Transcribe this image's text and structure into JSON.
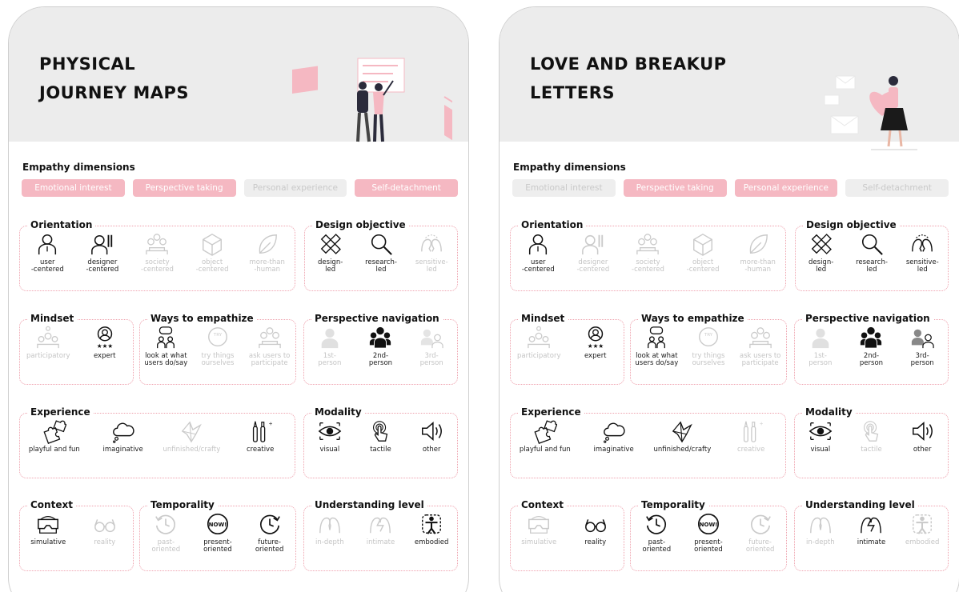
{
  "empathy_dimensions_title": "Empathy dimensions",
  "cards": [
    {
      "title": "PHYSICAL\nJOURNEY MAPS",
      "dimensions": [
        {
          "label": "Emotional interest",
          "active": true
        },
        {
          "label": "Perspective taking",
          "active": true
        },
        {
          "label": "Personal experience",
          "active": false
        },
        {
          "label": "Self-detachment",
          "active": true
        }
      ],
      "sections": [
        {
          "title": "Orientation",
          "items": [
            {
              "label": "user\n-centered",
              "icon": "user-icon",
              "active": true
            },
            {
              "label": "designer\n-centered",
              "icon": "designer-icon",
              "active": true
            },
            {
              "label": "society\n-centered",
              "icon": "crowd-icon",
              "active": false
            },
            {
              "label": "object\n-centered",
              "icon": "cube-icon",
              "active": false
            },
            {
              "label": "more-than\n-human",
              "icon": "leaf-icon",
              "active": false
            }
          ]
        },
        {
          "title": "Design objective",
          "items": [
            {
              "label": "design-\nled",
              "icon": "ruler-pencil-icon",
              "active": true
            },
            {
              "label": "research-\nled",
              "icon": "magnifier-icon",
              "active": true
            },
            {
              "label": "sensitive-\nled",
              "icon": "faces-icon",
              "active": false
            }
          ]
        },
        {
          "title": "Mindset",
          "items": [
            {
              "label": "participatory",
              "icon": "group-idea-icon",
              "active": false
            },
            {
              "label": "expert",
              "icon": "expert-icon",
              "active": true
            }
          ]
        },
        {
          "title": "Ways to empathize",
          "items": [
            {
              "label": "look at what\nusers do/say",
              "icon": "speech-people-icon",
              "active": true
            },
            {
              "label": "try things\nourselves",
              "icon": "try-icon",
              "active": false
            },
            {
              "label": "ask users to\nparticipate",
              "icon": "crowd-icon",
              "active": false
            }
          ]
        },
        {
          "title": "Perspective navigation",
          "items": [
            {
              "label": "1st-\nperson",
              "icon": "person-icon",
              "active": false
            },
            {
              "label": "2nd-\nperson",
              "icon": "group-icon",
              "active": true
            },
            {
              "label": "3rd-\nperson",
              "icon": "pair-icon",
              "active": false
            }
          ]
        },
        {
          "title": "Experience",
          "items": [
            {
              "label": "playful and fun",
              "icon": "puzzle-icon",
              "active": true
            },
            {
              "label": "imaginative",
              "icon": "cloud-icon",
              "active": true
            },
            {
              "label": "unfinished/crafty",
              "icon": "origami-icon",
              "active": false
            },
            {
              "label": "creative",
              "icon": "brushes-icon",
              "active": true
            }
          ]
        },
        {
          "title": "Modality",
          "items": [
            {
              "label": "visual",
              "icon": "eye-icon",
              "active": true
            },
            {
              "label": "tactile",
              "icon": "touch-icon",
              "active": true
            },
            {
              "label": "other",
              "icon": "speaker-icon",
              "active": true
            }
          ]
        },
        {
          "title": "Context",
          "items": [
            {
              "label": "simulative",
              "icon": "vr-icon",
              "active": true
            },
            {
              "label": "reality",
              "icon": "glasses-icon",
              "active": false
            }
          ]
        },
        {
          "title": "Temporality",
          "items": [
            {
              "label": "past-\noriented",
              "icon": "past-icon",
              "active": false
            },
            {
              "label": "present-\noriented",
              "icon": "now-icon",
              "active": true
            },
            {
              "label": "future-\noriented",
              "icon": "future-icon",
              "active": true
            }
          ]
        },
        {
          "title": "Understanding level",
          "items": [
            {
              "label": "in-depth",
              "icon": "head-pair-icon",
              "active": false
            },
            {
              "label": "intimate",
              "icon": "heads-icon",
              "active": false
            },
            {
              "label": "embodied",
              "icon": "body-icon",
              "active": true
            }
          ]
        }
      ]
    },
    {
      "title": "LOVE AND BREAKUP\nLETTERS",
      "dimensions": [
        {
          "label": "Emotional interest",
          "active": false
        },
        {
          "label": "Perspective taking",
          "active": true
        },
        {
          "label": "Personal experience",
          "active": true
        },
        {
          "label": "Self-detachment",
          "active": false
        }
      ],
      "sections": [
        {
          "title": "Orientation",
          "items": [
            {
              "label": "user\n-centered",
              "icon": "user-icon",
              "active": true
            },
            {
              "label": "designer\n-centered",
              "icon": "designer-icon",
              "active": false
            },
            {
              "label": "society\n-centered",
              "icon": "crowd-icon",
              "active": false
            },
            {
              "label": "object\n-centered",
              "icon": "cube-icon",
              "active": false
            },
            {
              "label": "more-than\n-human",
              "icon": "leaf-icon",
              "active": false
            }
          ]
        },
        {
          "title": "Design objective",
          "items": [
            {
              "label": "design-\nled",
              "icon": "ruler-pencil-icon",
              "active": true
            },
            {
              "label": "research-\nled",
              "icon": "magnifier-icon",
              "active": true
            },
            {
              "label": "sensitive-\nled",
              "icon": "faces-icon",
              "active": true
            }
          ]
        },
        {
          "title": "Mindset",
          "items": [
            {
              "label": "participatory",
              "icon": "group-idea-icon",
              "active": false
            },
            {
              "label": "expert",
              "icon": "expert-icon",
              "active": true
            }
          ]
        },
        {
          "title": "Ways to empathize",
          "items": [
            {
              "label": "look at what\nusers do/say",
              "icon": "speech-people-icon",
              "active": true
            },
            {
              "label": "try things\nourselves",
              "icon": "try-icon",
              "active": false
            },
            {
              "label": "ask users to\nparticipate",
              "icon": "crowd-icon",
              "active": false
            }
          ]
        },
        {
          "title": "Perspective navigation",
          "items": [
            {
              "label": "1st-\nperson",
              "icon": "person-icon",
              "active": false
            },
            {
              "label": "2nd-\nperson",
              "icon": "group-icon",
              "active": true
            },
            {
              "label": "3rd-\nperson",
              "icon": "pair-icon",
              "active": true
            }
          ]
        },
        {
          "title": "Experience",
          "items": [
            {
              "label": "playful and fun",
              "icon": "puzzle-icon",
              "active": true
            },
            {
              "label": "imaginative",
              "icon": "cloud-icon",
              "active": true
            },
            {
              "label": "unfinished/crafty",
              "icon": "origami-icon",
              "active": true
            },
            {
              "label": "creative",
              "icon": "brushes-icon",
              "active": false
            }
          ]
        },
        {
          "title": "Modality",
          "items": [
            {
              "label": "visual",
              "icon": "eye-icon",
              "active": true
            },
            {
              "label": "tactile",
              "icon": "touch-icon",
              "active": false
            },
            {
              "label": "other",
              "icon": "speaker-icon",
              "active": true
            }
          ]
        },
        {
          "title": "Context",
          "items": [
            {
              "label": "simulative",
              "icon": "vr-icon",
              "active": false
            },
            {
              "label": "reality",
              "icon": "glasses-icon",
              "active": true
            }
          ]
        },
        {
          "title": "Temporality",
          "items": [
            {
              "label": "past-\noriented",
              "icon": "past-icon",
              "active": true
            },
            {
              "label": "present-\noriented",
              "icon": "now-icon",
              "active": true
            },
            {
              "label": "future-\noriented",
              "icon": "future-icon",
              "active": false
            }
          ]
        },
        {
          "title": "Understanding level",
          "items": [
            {
              "label": "in-depth",
              "icon": "head-pair-icon",
              "active": false
            },
            {
              "label": "intimate",
              "icon": "heads-icon",
              "active": true
            },
            {
              "label": "embodied",
              "icon": "body-icon",
              "active": false
            }
          ]
        }
      ]
    }
  ],
  "colors": {
    "accent": "#f5b8c2",
    "inactive": "#eeeeee",
    "border": "#eea0ac"
  }
}
